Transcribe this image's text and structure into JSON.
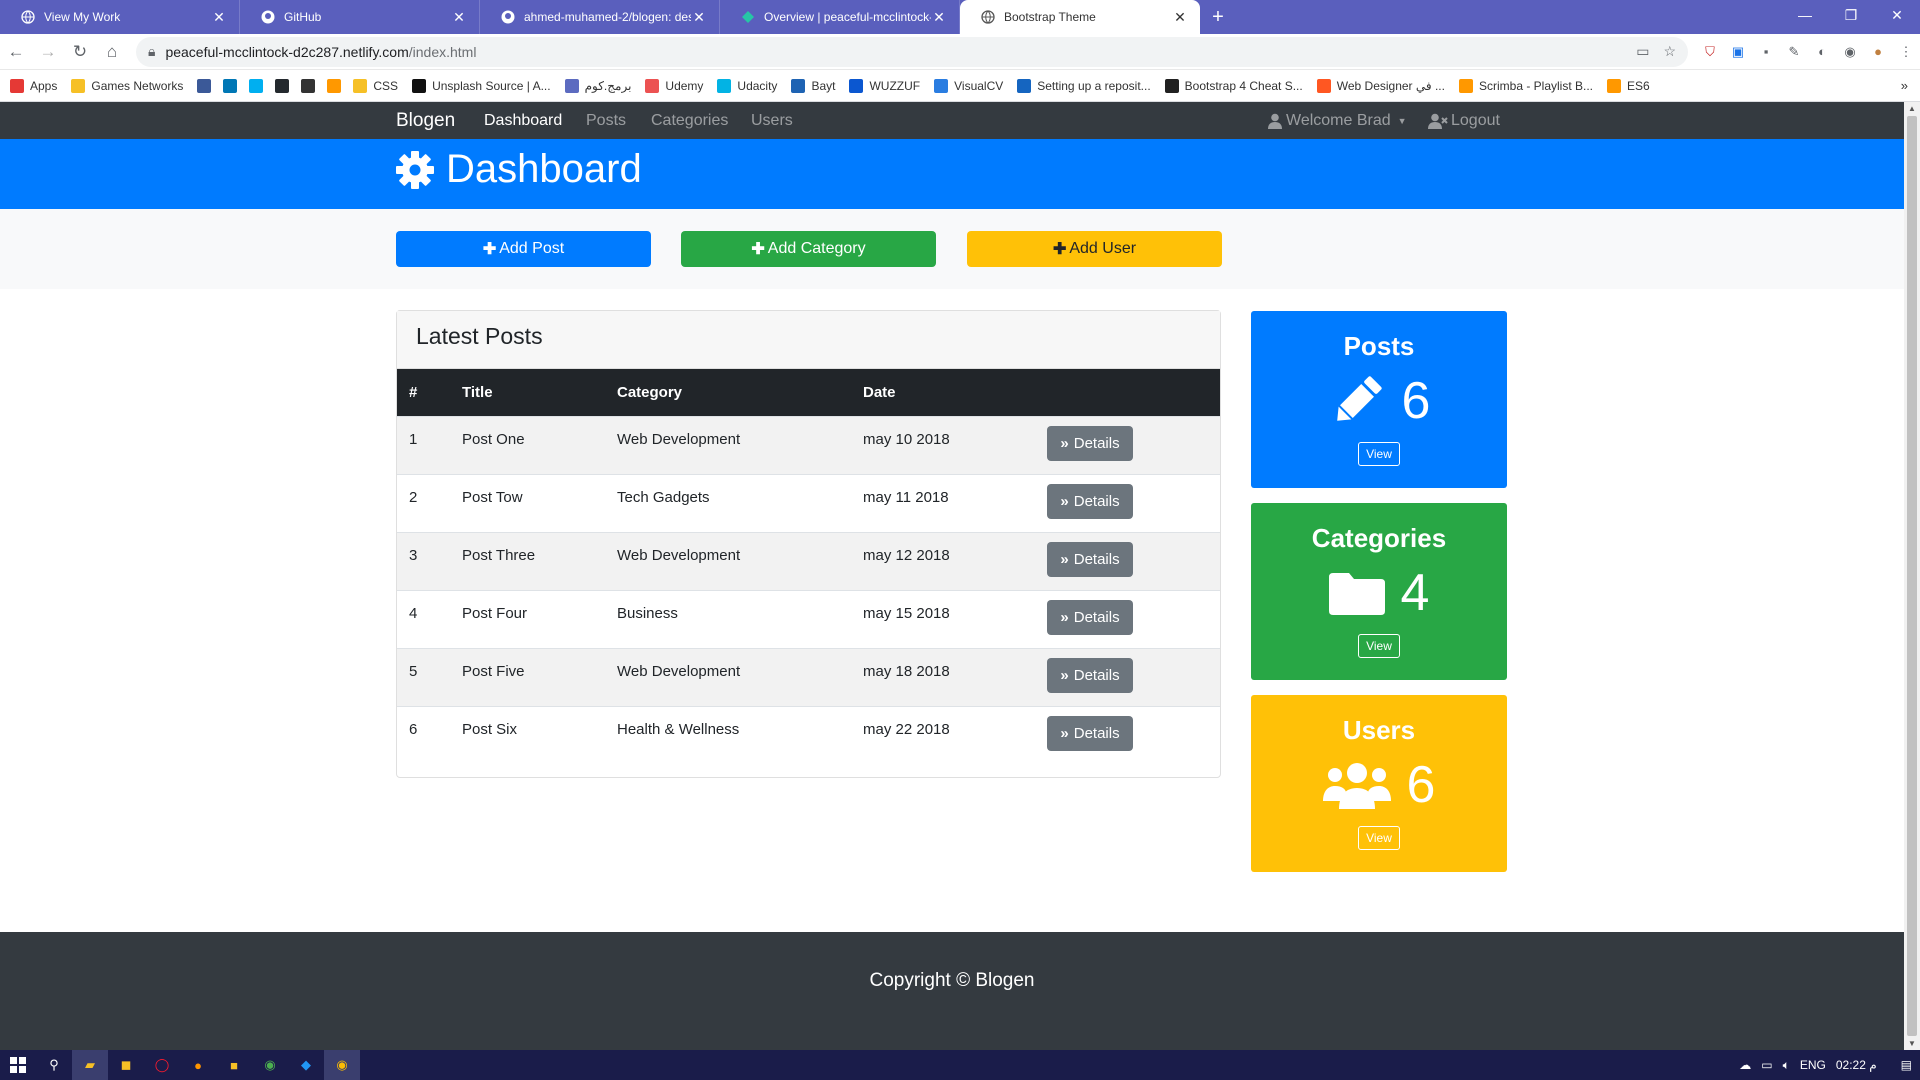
{
  "browser": {
    "tabs": [
      {
        "title": "View My Work",
        "icon": "globe-icon",
        "active": false
      },
      {
        "title": "GitHub",
        "icon": "github-icon",
        "active": false
      },
      {
        "title": "ahmed-muhamed-2/blogen: des",
        "icon": "github-icon",
        "active": false
      },
      {
        "title": "Overview | peaceful-mcclintock-d",
        "icon": "netlify-icon",
        "active": false
      },
      {
        "title": "Bootstrap Theme",
        "icon": "globe-icon",
        "active": true
      }
    ],
    "new_tab": "+",
    "url_host": "peaceful-mcclintock-d2c287.netlify.com",
    "url_path": "/index.html",
    "bookmarks": [
      {
        "label": "Apps",
        "color": "#e53935"
      },
      {
        "label": "Games Networks",
        "color": "#f6c026"
      },
      {
        "label": "",
        "color": "#3b5998"
      },
      {
        "label": "",
        "color": "#0077b5"
      },
      {
        "label": "",
        "color": "#00aff0"
      },
      {
        "label": "",
        "color": "#24292e"
      },
      {
        "label": "",
        "color": "#333333"
      },
      {
        "label": "",
        "color": "#ff9800"
      },
      {
        "label": "CSS",
        "color": "#f6c026"
      },
      {
        "label": "Unsplash Source | A...",
        "color": "#111111"
      },
      {
        "label": "برمج.كوم",
        "color": "#5c6bc0"
      },
      {
        "label": "Udemy",
        "color": "#ec5252"
      },
      {
        "label": "Udacity",
        "color": "#02b3e4"
      },
      {
        "label": "Bayt",
        "color": "#1e63b3"
      },
      {
        "label": "WUZZUF",
        "color": "#0b57d0"
      },
      {
        "label": "VisualCV",
        "color": "#2a7de1"
      },
      {
        "label": "Setting up a reposit...",
        "color": "#1565c0"
      },
      {
        "label": "Bootstrap 4 Cheat S...",
        "color": "#212121"
      },
      {
        "label": "Web Designer في ...",
        "color": "#ff5722"
      },
      {
        "label": "Scrimba - Playlist B...",
        "color": "#ff9800"
      },
      {
        "label": "ES6",
        "color": "#ff9800"
      }
    ]
  },
  "navbar": {
    "brand": "Blogen",
    "links": [
      "Dashboard",
      "Posts",
      "Categories",
      "Users"
    ],
    "welcome": "Welcome Brad",
    "logout": "Logout"
  },
  "header": {
    "title": "Dashboard"
  },
  "actions": {
    "add_post": "Add Post",
    "add_category": "Add Category",
    "add_user": "Add User"
  },
  "latest_posts": {
    "title": "Latest Posts",
    "columns": [
      "#",
      "Title",
      "Category",
      "Date"
    ],
    "details_label": "Details",
    "rows": [
      {
        "num": "1",
        "title": "Post One",
        "category": "Web Development",
        "date": "may 10 2018"
      },
      {
        "num": "2",
        "title": "Post Tow",
        "category": "Tech Gadgets",
        "date": "may 11 2018"
      },
      {
        "num": "3",
        "title": "Post Three",
        "category": "Web Development",
        "date": "may 12 2018"
      },
      {
        "num": "4",
        "title": "Post Four",
        "category": "Business",
        "date": "may 15 2018"
      },
      {
        "num": "5",
        "title": "Post Five",
        "category": "Web Development",
        "date": "may 18 2018"
      },
      {
        "num": "6",
        "title": "Post Six",
        "category": "Health & Wellness",
        "date": "may 22 2018"
      }
    ]
  },
  "stats": [
    {
      "title": "Posts",
      "count": "6",
      "view": "View",
      "icon": "pencil-icon",
      "color": "#007bff"
    },
    {
      "title": "Categories",
      "count": "4",
      "view": "View",
      "icon": "folder-icon",
      "color": "#28a745"
    },
    {
      "title": "Users",
      "count": "6",
      "view": "View",
      "icon": "users-icon",
      "color": "#ffc107"
    }
  ],
  "footer": {
    "copyright": "Copyright © Blogen"
  },
  "taskbar": {
    "lang": "ENG",
    "time": "02:22 م"
  },
  "colors": {
    "primary": "#007bff",
    "success": "#28a745",
    "warning": "#ffc107",
    "dark": "#343a40",
    "secondary": "#6c757d"
  }
}
